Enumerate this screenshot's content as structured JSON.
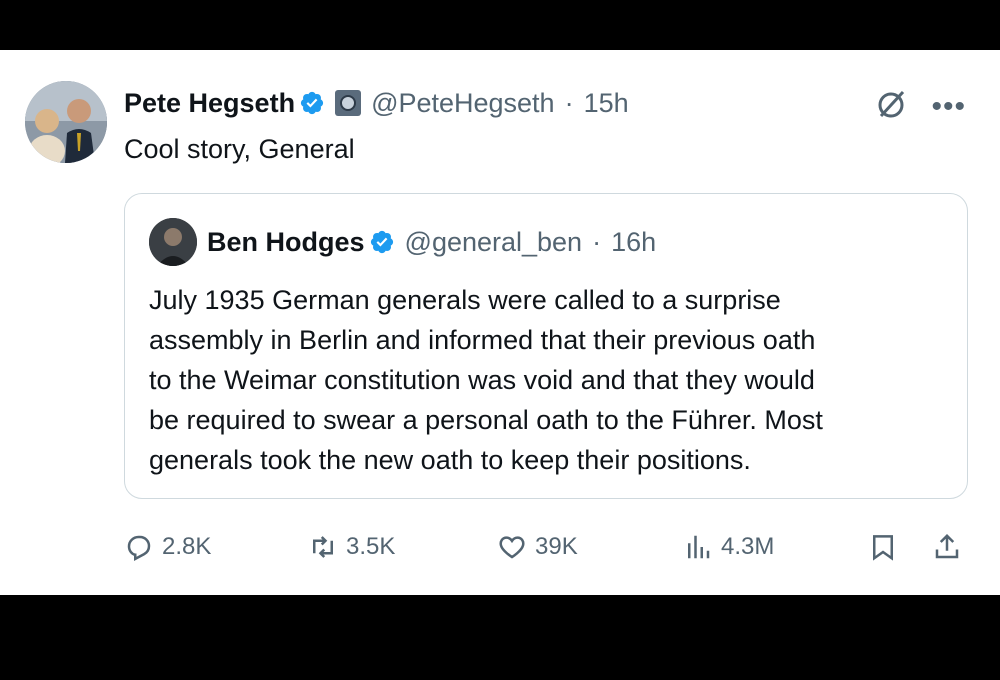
{
  "post": {
    "author_name": "Pete Hegseth",
    "handle": "@PeteHegseth",
    "separator": "·",
    "time": "15h",
    "text": "Cool story, General"
  },
  "quote": {
    "author_name": "Ben Hodges",
    "handle": "@general_ben",
    "separator": "·",
    "time": "16h",
    "lines": [
      "July 1935 German generals were called to a surprise",
      "assembly in Berlin and informed that their previous oath",
      "to the Weimar constitution was void and that they would",
      "be required to swear a personal oath to the Führer. Most",
      "generals took the new oath to keep their positions."
    ]
  },
  "actions": {
    "replies": "2.8K",
    "reposts": "3.5K",
    "likes": "39K",
    "views": "4.3M"
  },
  "icons": {
    "verified": "verified-badge-icon",
    "reply": "reply-icon",
    "repost": "repost-icon",
    "like": "heart-icon",
    "views": "views-icon",
    "bookmark": "bookmark-icon",
    "share": "share-icon",
    "grok": "grok-icon",
    "more": "more-icon"
  },
  "colors": {
    "verified_blue": "#1d9bf0",
    "secondary_text": "#536471",
    "primary_text": "#0f1419",
    "border": "#cfd9de"
  }
}
